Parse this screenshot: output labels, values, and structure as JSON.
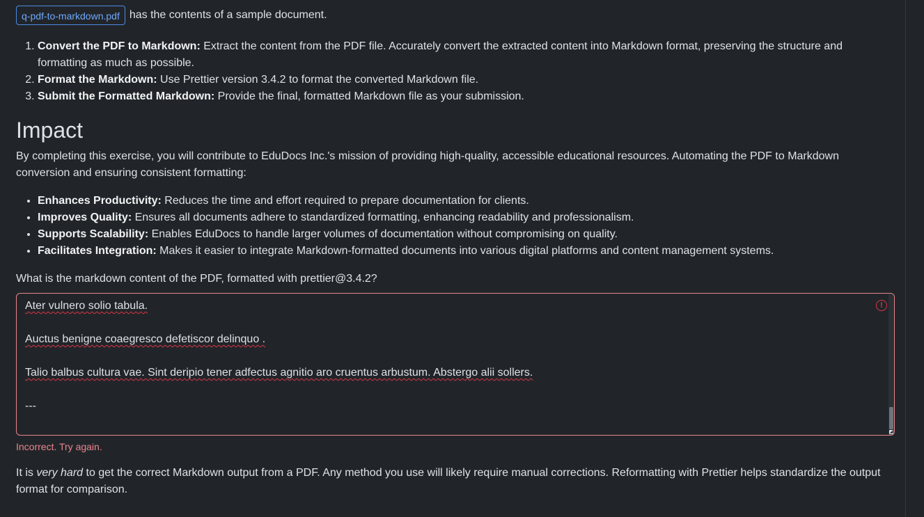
{
  "attachment": {
    "file_name": "q-pdf-to-markdown.pdf",
    "suffix_text": "has the contents of a sample document."
  },
  "steps": [
    {
      "title": "Convert the PDF to Markdown:",
      "text": " Extract the content from the PDF file. Accurately convert the extracted content into Markdown format, preserving the structure and formatting as much as possible."
    },
    {
      "title": "Format the Markdown:",
      "text": " Use Prettier version 3.4.2 to format the converted Markdown file."
    },
    {
      "title": "Submit the Formatted Markdown:",
      "text": " Provide the final, formatted Markdown file as your submission."
    }
  ],
  "impact": {
    "heading": "Impact",
    "intro": "By completing this exercise, you will contribute to EduDocs Inc.'s mission of providing high-quality, accessible educational resources. Automating the PDF to Markdown conversion and ensuring consistent formatting:",
    "bullets": [
      {
        "title": "Enhances Productivity:",
        "text": " Reduces the time and effort required to prepare documentation for clients."
      },
      {
        "title": "Improves Quality:",
        "text": " Ensures all documents adhere to standardized formatting, enhancing readability and professionalism."
      },
      {
        "title": "Supports Scalability:",
        "text": " Enables EduDocs to handle larger volumes of documentation without compromising on quality."
      },
      {
        "title": "Facilitates Integration:",
        "text": " Makes it easier to integrate Markdown-formatted documents into various digital platforms and content management systems."
      }
    ]
  },
  "question": "What is the markdown content of the PDF, formatted with prettier@3.4.2?",
  "answer": {
    "lines": [
      "Ater vulnero solio tabula.",
      "",
      "Auctus benigne coaegresco defetiscor delinquo .",
      "",
      "Talio balbus cultura vae. Sint deripio tener adfectus agnitio aro cruentus arbustum. Abstergo alii sollers.",
      "",
      "---"
    ],
    "status": "invalid",
    "error_color": "#dc3545"
  },
  "feedback": "Incorrect. Try again.",
  "note": {
    "before": "It is ",
    "emphasis": "very hard",
    "after": " to get the correct Markdown output from a PDF. Any method you use will likely require manual corrections. Reformatting with Prettier helps standardize the output format for comparison."
  },
  "colors": {
    "background": "#212529",
    "text": "#dee2e6",
    "link": "#6ea8fe",
    "invalid": "#ea868f"
  }
}
